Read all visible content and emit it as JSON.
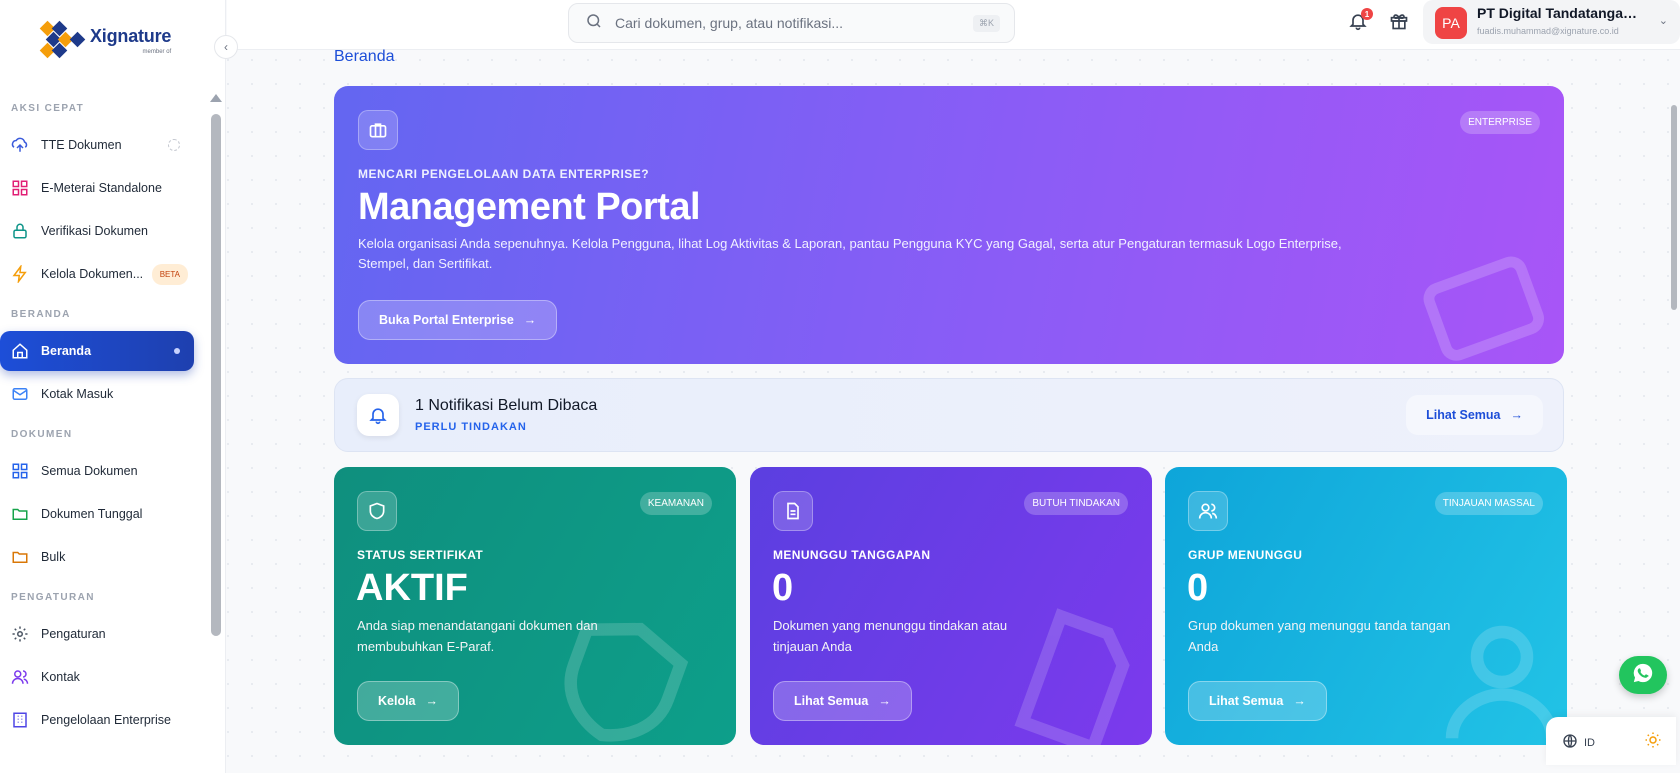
{
  "brand": {
    "name": "Xignature",
    "sub": "member of"
  },
  "sidebar": {
    "sections": [
      {
        "title": "AKSI CEPAT"
      },
      {
        "title": "BERANDA"
      },
      {
        "title": "DOKUMEN"
      },
      {
        "title": "PENGATURAN"
      }
    ],
    "items": [
      {
        "label": "TTE Dokumen",
        "icon": "upload-cloud-icon"
      },
      {
        "label": "E-Meterai Standalone",
        "icon": "grid-icon"
      },
      {
        "label": "Verifikasi Dokumen",
        "icon": "lock-icon"
      },
      {
        "label": "Kelola Dokumen...",
        "icon": "bolt-icon",
        "badge": "BETA"
      },
      {
        "label": "Beranda",
        "icon": "home-icon",
        "active": true
      },
      {
        "label": "Kotak Masuk",
        "icon": "mail-icon"
      },
      {
        "label": "Semua Dokumen",
        "icon": "grid-icon"
      },
      {
        "label": "Dokumen Tunggal",
        "icon": "folder-icon"
      },
      {
        "label": "Bulk",
        "icon": "folder-icon"
      },
      {
        "label": "Pengaturan",
        "icon": "gear-icon"
      },
      {
        "label": "Kontak",
        "icon": "users-icon"
      },
      {
        "label": "Pengelolaan Enterprise",
        "icon": "building-icon"
      }
    ]
  },
  "topbar": {
    "search_placeholder": "Cari dokumen, grup, atau notifikasi...",
    "search_shortcut": "⌘K",
    "notification_count": "1",
    "profile": {
      "initials": "PA",
      "name": "PT Digital Tandatangan Asli",
      "email": "fuadis.muhammad@xignature.co.id"
    }
  },
  "main": {
    "breadcrumb": "Beranda",
    "hero": {
      "tag": "ENTERPRISE",
      "eyebrow": "MENCARI PENGELOLAAN DATA ENTERPRISE?",
      "title": "Management Portal",
      "description": "Kelola organisasi Anda sepenuhnya. Kelola Pengguna, lihat Log Aktivitas & Laporan, pantau Pengguna KYC yang Gagal, serta atur Pengaturan termasuk Logo Enterprise, Stempel, dan Sertifikat.",
      "button": "Buka Portal Enterprise"
    },
    "notification": {
      "title": "1 Notifikasi Belum Dibaca",
      "subtitle": "PERLU TINDAKAN",
      "button": "Lihat Semua"
    },
    "cards": [
      {
        "tag": "KEAMANAN",
        "label": "STATUS SERTIFIKAT",
        "value": "AKTIF",
        "description": "Anda siap menandatangani dokumen dan membubuhkan E-Paraf.",
        "button": "Kelola",
        "color_from": "#0f8f7e",
        "color_to": "#0d9f8a"
      },
      {
        "tag": "BUTUH TINDAKAN",
        "label": "MENUNGGU TANGGAPAN",
        "value": "0",
        "description": "Dokumen yang menunggu tindakan atau tinjauan Anda",
        "button": "Lihat Semua",
        "color_from": "#5b3fe0",
        "color_to": "#7c3aed"
      },
      {
        "tag": "TINJAUAN MASSAL",
        "label": "GRUP MENUNGGU",
        "value": "0",
        "description": "Grup dokumen yang menunggu tanda tangan Anda",
        "button": "Lihat Semua",
        "color_from": "#0ea5d9",
        "color_to": "#22c3e6"
      }
    ]
  },
  "footer_tools": {
    "language": "ID"
  },
  "colors": {
    "primary": "#1d4ed8",
    "hero_from": "#6366f1",
    "hero_to": "#a855f7",
    "whatsapp": "#22c55e"
  }
}
